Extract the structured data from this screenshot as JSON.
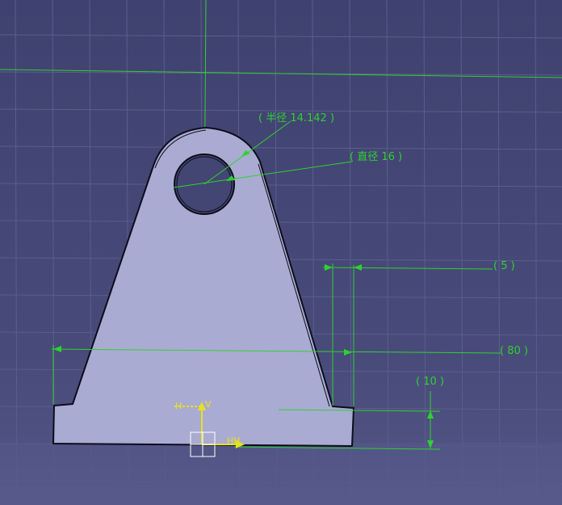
{
  "sketch": {
    "dimensions": {
      "radius": "( 半径 14.142 )",
      "diameter": "( 直径 16 )",
      "dim_5": "( 5 )",
      "dim_80": "( 80 )",
      "dim_10": "( 10 )"
    },
    "axis": {
      "h_label": "H",
      "v_label": "V",
      "hh_label": "HH"
    }
  },
  "colors": {
    "background": "#434673",
    "grid": "#5b5e8c",
    "part_fill": "#a9abd3",
    "part_outline": "#0d0d1a",
    "dimension": "#2fd12f",
    "axis": "#e8e020"
  }
}
